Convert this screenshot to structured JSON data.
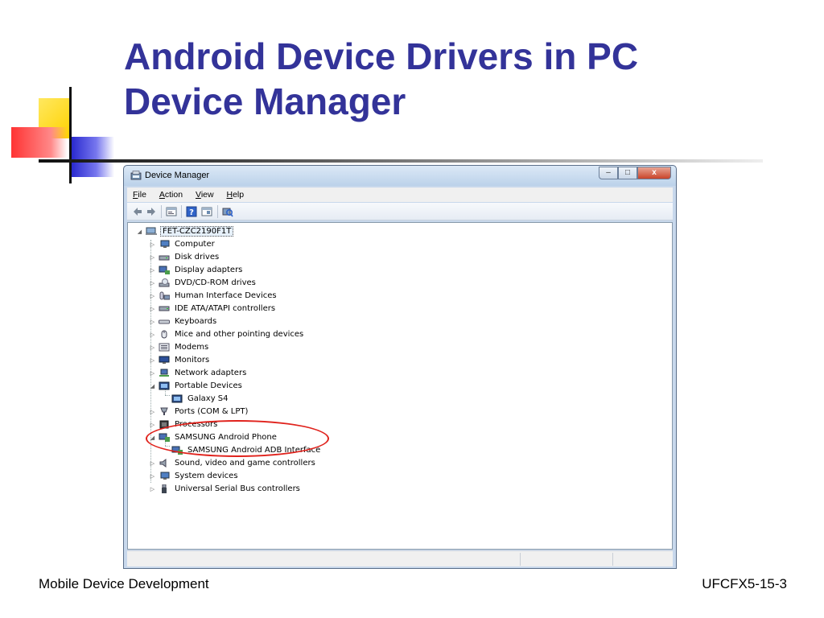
{
  "slide": {
    "title_line1": "Android Device Drivers in PC",
    "title_line2": "Device Manager",
    "footer_left": "Mobile Device Development",
    "footer_right": "UFCFX5-15-3",
    "title_color": "#333399",
    "annotation_color": "#e0221c"
  },
  "window": {
    "title": "Device Manager",
    "icon": "device-manager-icon",
    "controls": {
      "minimize": "–",
      "maximize": "□",
      "close": "x"
    }
  },
  "menubar": {
    "file": {
      "u": "F",
      "rest": "ile"
    },
    "action": {
      "u": "A",
      "rest": "ction"
    },
    "view": {
      "u": "V",
      "rest": "iew"
    },
    "help": {
      "u": "H",
      "rest": "elp"
    }
  },
  "toolbar": {
    "icons": [
      "back-arrow-icon",
      "forward-arrow-icon",
      "properties-icon",
      "help-icon",
      "view-icon",
      "scan-hardware-icon"
    ]
  },
  "tree": {
    "root": "FET-CZC2190F1T",
    "items": [
      {
        "label": "Computer",
        "icon": "computer-icon",
        "expanded": false
      },
      {
        "label": "Disk drives",
        "icon": "disk-drive-icon",
        "expanded": false
      },
      {
        "label": "Display adapters",
        "icon": "display-adapter-icon",
        "expanded": false
      },
      {
        "label": "DVD/CD-ROM drives",
        "icon": "dvd-drive-icon",
        "expanded": false
      },
      {
        "label": "Human Interface Devices",
        "icon": "hid-icon",
        "expanded": false
      },
      {
        "label": "IDE ATA/ATAPI controllers",
        "icon": "ide-controller-icon",
        "expanded": false
      },
      {
        "label": "Keyboards",
        "icon": "keyboard-icon",
        "expanded": false
      },
      {
        "label": "Mice and other pointing devices",
        "icon": "mouse-icon",
        "expanded": false
      },
      {
        "label": "Modems",
        "icon": "modem-icon",
        "expanded": false
      },
      {
        "label": "Monitors",
        "icon": "monitor-icon",
        "expanded": false
      },
      {
        "label": "Network adapters",
        "icon": "network-adapter-icon",
        "expanded": false
      },
      {
        "label": "Portable Devices",
        "icon": "portable-device-icon",
        "expanded": true
      },
      {
        "label": "Galaxy S4",
        "icon": "portable-device-icon",
        "child": true
      },
      {
        "label": "Ports (COM & LPT)",
        "icon": "port-icon",
        "expanded": false
      },
      {
        "label": "Processors",
        "icon": "processor-icon",
        "expanded": false
      },
      {
        "label": "SAMSUNG Android Phone",
        "icon": "phone-device-icon",
        "expanded": true
      },
      {
        "label": "SAMSUNG Android ADB Interface",
        "icon": "adb-interface-icon",
        "child": true
      },
      {
        "label": "Sound, video and game controllers",
        "icon": "sound-icon",
        "expanded": false
      },
      {
        "label": "System devices",
        "icon": "system-device-icon",
        "expanded": false
      },
      {
        "label": "Universal Serial Bus controllers",
        "icon": "usb-icon",
        "expanded": false
      }
    ]
  }
}
